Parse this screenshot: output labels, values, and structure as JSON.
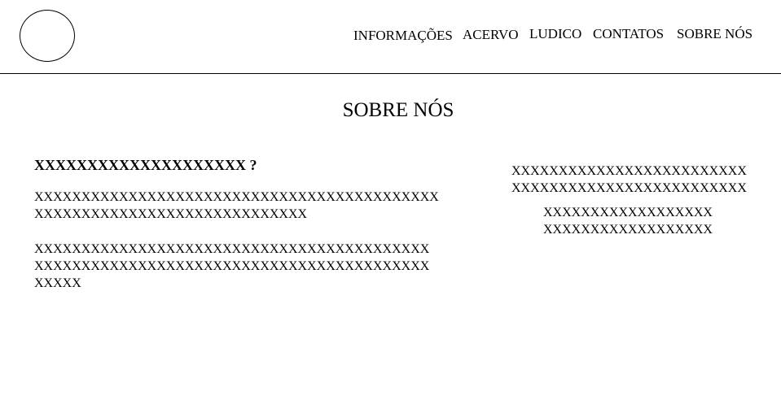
{
  "header": {
    "nav": [
      {
        "label": "INFORMAÇÕES"
      },
      {
        "label": "ACERVO"
      },
      {
        "label": "LUDICO"
      },
      {
        "label": "CONTATOS"
      },
      {
        "label": "SOBRE NÓS"
      }
    ]
  },
  "main": {
    "title": "SOBRE NÓS",
    "question": "XXXXXXXXXXXXXXXXXXXX ?",
    "paragraph1": [
      "XXXXXXXXXXXXXXXXXXXXXXXXXXXXXXXXXXXXXXXXXXX",
      "XXXXXXXXXXXXXXXXXXXXXXXXXXXXX"
    ],
    "paragraph2": [
      "XXXXXXXXXXXXXXXXXXXXXXXXXXXXXXXXXXXXXXXXXX",
      "XXXXXXXXXXXXXXXXXXXXXXXXXXXXXXXXXXXXXXXXXX",
      "XXXXX"
    ],
    "sidebar_block1": [
      "XXXXXXXXXXXXXXXXXXXXXXXXX",
      "XXXXXXXXXXXXXXXXXXXXXXXXX"
    ],
    "sidebar_block2": [
      "XXXXXXXXXXXXXXXXXX",
      "XXXXXXXXXXXXXXXXXX"
    ]
  }
}
